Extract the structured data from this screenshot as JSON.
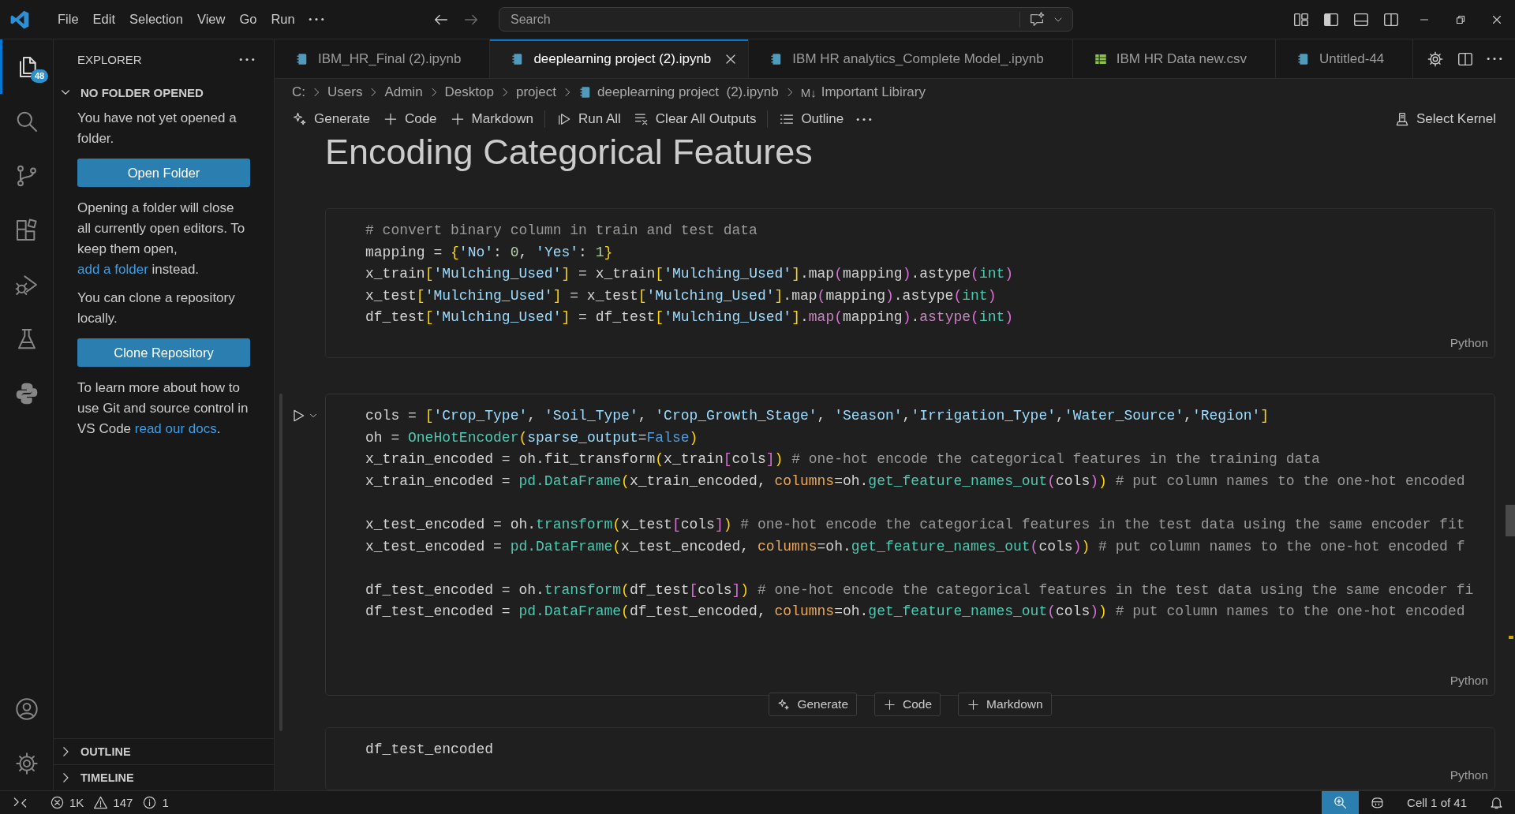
{
  "title_bar": {
    "menu": [
      "File",
      "Edit",
      "Selection",
      "View",
      "Go",
      "Run"
    ],
    "search": {
      "placeholder": "Search"
    }
  },
  "activity_bar": {
    "items": [
      {
        "kind": "files",
        "selected": true,
        "badge": "48"
      },
      {
        "kind": "search",
        "selected": false
      },
      {
        "kind": "source_control",
        "selected": false
      },
      {
        "kind": "extensions",
        "selected": false
      },
      {
        "kind": "run_debug",
        "selected": false
      },
      {
        "kind": "testing",
        "selected": false
      },
      {
        "kind": "python",
        "selected": false
      }
    ],
    "bottom": [
      {
        "kind": "accounts"
      },
      {
        "kind": "manage"
      }
    ]
  },
  "sidebar": {
    "title": "EXPLORER",
    "section": {
      "title": "NO FOLDER OPENED",
      "expanded": true
    },
    "content": [
      {
        "kind": "text",
        "text": "You have not yet opened a folder."
      },
      {
        "kind": "button",
        "label": "Open Folder"
      },
      {
        "kind": "text",
        "text": "Opening a folder will close all currently open editors. To keep them open, ",
        "link": "add a folder",
        "after": " instead."
      },
      {
        "kind": "text",
        "text": "You can clone a repository locally."
      },
      {
        "kind": "button",
        "label": "Clone Repository"
      },
      {
        "kind": "text",
        "text": "To learn more about how to use Git and source control in VS Code ",
        "link": "read our docs",
        "after": "."
      }
    ],
    "panels": [
      {
        "title": "OUTLINE",
        "expanded": false
      },
      {
        "title": "TIMELINE",
        "expanded": false
      }
    ]
  },
  "editor": {
    "tabs": [
      {
        "label": "IBM_HR_Final (2).ipynb",
        "kind": "notebook",
        "selected": false
      },
      {
        "label": "deeplearning project (2).ipynb",
        "kind": "notebook",
        "selected": true
      },
      {
        "label": "IBM HR analytics_Complete Model_.ipynb",
        "kind": "notebook",
        "selected": false
      },
      {
        "label": "IBM HR Data new.csv",
        "kind": "csv",
        "selected": false
      },
      {
        "label": "Untitled-44",
        "kind": "notebook",
        "selected": false
      }
    ],
    "breadcrumbs": [
      {
        "kind": "folder",
        "label": "C:"
      },
      {
        "kind": "folder",
        "label": "Users"
      },
      {
        "kind": "folder",
        "label": "Admin"
      },
      {
        "kind": "folder",
        "label": "Desktop"
      },
      {
        "kind": "folder",
        "label": "project"
      },
      {
        "kind": "notebook",
        "label": "deeplearning project  (2).ipynb"
      },
      {
        "kind": "markdown",
        "marker": "M↓",
        "label": "Important Libirary"
      }
    ],
    "toolbar": [
      {
        "kind": "generate",
        "label": "Generate"
      },
      {
        "kind": "add",
        "label": "Code"
      },
      {
        "kind": "add",
        "label": "Markdown"
      },
      {
        "kind": "separator"
      },
      {
        "kind": "run_all",
        "label": "Run All"
      },
      {
        "kind": "clear",
        "label": "Clear All Outputs"
      },
      {
        "kind": "separator"
      },
      {
        "kind": "outline",
        "label": "Outline"
      },
      {
        "kind": "more"
      }
    ],
    "kernel": "Select Kernel",
    "cells": [
      {
        "kind": "markdown",
        "heading": "Encoding Categorical Features"
      },
      {
        "kind": "code",
        "language": "Python",
        "focused": false,
        "lines": [
          {
            "tokens": [
              {
                "text": "# convert binary column in train and test data",
                "kind": "c"
              }
            ]
          },
          {
            "tokens": [
              {
                "text": "mapping = ",
                "kind": "p"
              },
              {
                "text": "{",
                "kind": "y"
              },
              {
                "text": "'No'",
                "kind": "s"
              },
              {
                "text": ": ",
                "kind": "p"
              },
              {
                "text": "0",
                "kind": "n"
              },
              {
                "text": ", ",
                "kind": "p"
              },
              {
                "text": "'Yes'",
                "kind": "s"
              },
              {
                "text": ": ",
                "kind": "p"
              },
              {
                "text": "1",
                "kind": "n"
              },
              {
                "text": "}",
                "kind": "y"
              }
            ]
          },
          {
            "tokens": [
              {
                "text": "x_train",
                "kind": "p"
              },
              {
                "text": "[",
                "kind": "y"
              },
              {
                "text": "'Mulching_Used'",
                "kind": "s"
              },
              {
                "text": "]",
                "kind": "y"
              },
              {
                "text": " = x_train",
                "kind": "p"
              },
              {
                "text": "[",
                "kind": "y"
              },
              {
                "text": "'Mulching_Used'",
                "kind": "s"
              },
              {
                "text": "]",
                "kind": "y"
              },
              {
                "text": ".map",
                "kind": "p"
              },
              {
                "text": "(",
                "kind": "m"
              },
              {
                "text": "mapping",
                "kind": "p"
              },
              {
                "text": ")",
                "kind": "m"
              },
              {
                "text": ".astype",
                "kind": "p"
              },
              {
                "text": "(",
                "kind": "m"
              },
              {
                "text": "int",
                "kind": "t"
              },
              {
                "text": ")",
                "kind": "m"
              }
            ]
          },
          {
            "tokens": [
              {
                "text": "x_test",
                "kind": "p"
              },
              {
                "text": "[",
                "kind": "y"
              },
              {
                "text": "'Mulching_Used'",
                "kind": "s"
              },
              {
                "text": "]",
                "kind": "y"
              },
              {
                "text": " = x_test",
                "kind": "p"
              },
              {
                "text": "[",
                "kind": "y"
              },
              {
                "text": "'Mulching_Used'",
                "kind": "s"
              },
              {
                "text": "]",
                "kind": "y"
              },
              {
                "text": ".map",
                "kind": "p"
              },
              {
                "text": "(",
                "kind": "m"
              },
              {
                "text": "mapping",
                "kind": "p"
              },
              {
                "text": ")",
                "kind": "m"
              },
              {
                "text": ".astype",
                "kind": "p"
              },
              {
                "text": "(",
                "kind": "m"
              },
              {
                "text": "int",
                "kind": "t"
              },
              {
                "text": ")",
                "kind": "m"
              }
            ]
          },
          {
            "tokens": [
              {
                "text": "df_test",
                "kind": "p"
              },
              {
                "text": "[",
                "kind": "y"
              },
              {
                "text": "'Mulching_Used'",
                "kind": "s"
              },
              {
                "text": "]",
                "kind": "y"
              },
              {
                "text": " = df_test",
                "kind": "p"
              },
              {
                "text": "[",
                "kind": "y"
              },
              {
                "text": "'Mulching_Used'",
                "kind": "s"
              },
              {
                "text": "]",
                "kind": "y"
              },
              {
                "text": ".",
                "kind": "p"
              },
              {
                "text": "map",
                "kind": "u"
              },
              {
                "text": "(",
                "kind": "m"
              },
              {
                "text": "mapping",
                "kind": "p"
              },
              {
                "text": ")",
                "kind": "m"
              },
              {
                "text": ".",
                "kind": "p"
              },
              {
                "text": "astype",
                "kind": "u"
              },
              {
                "text": "(",
                "kind": "m"
              },
              {
                "text": "int",
                "kind": "t"
              },
              {
                "text": ")",
                "kind": "m"
              }
            ]
          }
        ]
      },
      {
        "kind": "code",
        "language": "Python",
        "focused": true,
        "lines": [
          {
            "tokens": [
              {
                "text": "cols = ",
                "kind": "p"
              },
              {
                "text": "[",
                "kind": "y"
              },
              {
                "text": "'Crop_Type'",
                "kind": "s"
              },
              {
                "text": ", ",
                "kind": "p"
              },
              {
                "text": "'Soil_Type'",
                "kind": "s"
              },
              {
                "text": ", ",
                "kind": "p"
              },
              {
                "text": "'Crop_Growth_Stage'",
                "kind": "s"
              },
              {
                "text": ", ",
                "kind": "p"
              },
              {
                "text": "'Season'",
                "kind": "s"
              },
              {
                "text": ",",
                "kind": "p"
              },
              {
                "text": "'Irrigation_Type'",
                "kind": "s"
              },
              {
                "text": ",",
                "kind": "p"
              },
              {
                "text": "'Water_Source'",
                "kind": "s"
              },
              {
                "text": ",",
                "kind": "p"
              },
              {
                "text": "'Region'",
                "kind": "s"
              },
              {
                "text": "]",
                "kind": "y"
              }
            ]
          },
          {
            "tokens": [
              {
                "text": "oh = ",
                "kind": "p"
              },
              {
                "text": "OneHotEncoder",
                "kind": "t"
              },
              {
                "text": "(",
                "kind": "y"
              },
              {
                "text": "sparse_output",
                "kind": "s"
              },
              {
                "text": "=",
                "kind": "p"
              },
              {
                "text": "False",
                "kind": "k"
              },
              {
                "text": ")",
                "kind": "y"
              }
            ]
          },
          {
            "tokens": [
              {
                "text": "x_train_encoded = oh.fit_transform",
                "kind": "p"
              },
              {
                "text": "(",
                "kind": "y"
              },
              {
                "text": "x_train",
                "kind": "p"
              },
              {
                "text": "[",
                "kind": "m"
              },
              {
                "text": "cols",
                "kind": "p"
              },
              {
                "text": "]",
                "kind": "m"
              },
              {
                "text": ")",
                "kind": "y"
              },
              {
                "text": " # one-hot encode the categorical features in the training data",
                "kind": "c"
              }
            ]
          },
          {
            "tokens": [
              {
                "text": "x_train_encoded = ",
                "kind": "p"
              },
              {
                "text": "pd.DataFrame",
                "kind": "t"
              },
              {
                "text": "(",
                "kind": "y"
              },
              {
                "text": "x_train_encoded, ",
                "kind": "p"
              },
              {
                "text": "columns",
                "kind": "o"
              },
              {
                "text": "=oh.",
                "kind": "p"
              },
              {
                "text": "get_feature_names_out",
                "kind": "t"
              },
              {
                "text": "(",
                "kind": "m"
              },
              {
                "text": "cols",
                "kind": "p"
              },
              {
                "text": ")",
                "kind": "m"
              },
              {
                "text": ")",
                "kind": "y"
              },
              {
                "text": " # put column names to the one-hot encoded",
                "kind": "c"
              }
            ]
          },
          {
            "kind": "blank"
          },
          {
            "tokens": [
              {
                "text": "x_test_encoded = oh.",
                "kind": "p"
              },
              {
                "text": "transform",
                "kind": "t"
              },
              {
                "text": "(",
                "kind": "y"
              },
              {
                "text": "x_test",
                "kind": "p"
              },
              {
                "text": "[",
                "kind": "m"
              },
              {
                "text": "cols",
                "kind": "p"
              },
              {
                "text": "]",
                "kind": "m"
              },
              {
                "text": ")",
                "kind": "y"
              },
              {
                "text": " # one-hot encode the categorical features in the test data using the same encoder fit",
                "kind": "c"
              }
            ]
          },
          {
            "tokens": [
              {
                "text": "x_test_encoded = ",
                "kind": "p"
              },
              {
                "text": "pd.DataFrame",
                "kind": "t"
              },
              {
                "text": "(",
                "kind": "y"
              },
              {
                "text": "x_test_encoded, ",
                "kind": "p"
              },
              {
                "text": "columns",
                "kind": "o"
              },
              {
                "text": "=oh.",
                "kind": "p"
              },
              {
                "text": "get_feature_names_out",
                "kind": "t"
              },
              {
                "text": "(",
                "kind": "m"
              },
              {
                "text": "cols",
                "kind": "p"
              },
              {
                "text": ")",
                "kind": "m"
              },
              {
                "text": ")",
                "kind": "y"
              },
              {
                "text": " # put column names to the one-hot encoded f",
                "kind": "c"
              }
            ]
          },
          {
            "kind": "blank"
          },
          {
            "tokens": [
              {
                "text": "df_test_encoded = oh.",
                "kind": "p"
              },
              {
                "text": "transform",
                "kind": "t"
              },
              {
                "text": "(",
                "kind": "y"
              },
              {
                "text": "df_test",
                "kind": "p"
              },
              {
                "text": "[",
                "kind": "m"
              },
              {
                "text": "cols",
                "kind": "p"
              },
              {
                "text": "]",
                "kind": "m"
              },
              {
                "text": ")",
                "kind": "y"
              },
              {
                "text": " # one-hot encode the categorical features in the test data using the same encoder fi",
                "kind": "c"
              }
            ]
          },
          {
            "tokens": [
              {
                "text": "df_test_encoded = ",
                "kind": "p"
              },
              {
                "text": "pd.DataFrame",
                "kind": "t"
              },
              {
                "text": "(",
                "kind": "y"
              },
              {
                "text": "df_test_encoded, ",
                "kind": "p"
              },
              {
                "text": "columns",
                "kind": "o"
              },
              {
                "text": "=oh.",
                "kind": "p"
              },
              {
                "text": "get_feature_names_out",
                "kind": "t"
              },
              {
                "text": "(",
                "kind": "m"
              },
              {
                "text": "cols",
                "kind": "p"
              },
              {
                "text": ")",
                "kind": "m"
              },
              {
                "text": ")",
                "kind": "y"
              },
              {
                "text": " # put column names to the one-hot encoded",
                "kind": "c"
              }
            ]
          },
          {
            "kind": "blank"
          },
          {
            "kind": "blank"
          }
        ]
      },
      {
        "kind": "insert_toolbar",
        "actions": [
          {
            "kind": "generate",
            "label": "Generate"
          },
          {
            "kind": "add",
            "label": "Code"
          },
          {
            "kind": "add",
            "label": "Markdown"
          }
        ]
      },
      {
        "kind": "code",
        "language": "Python",
        "focused": false,
        "lines": [
          {
            "tokens": [
              {
                "text": "df_test_encoded",
                "kind": "p"
              }
            ]
          }
        ]
      }
    ]
  },
  "status_bar": {
    "left": [
      {
        "kind": "remote"
      },
      {
        "kind": "errors",
        "text": "1K"
      },
      {
        "kind": "warnings",
        "text": "147"
      },
      {
        "kind": "info",
        "text": "1"
      }
    ],
    "right": [
      {
        "kind": "zoom",
        "active": true
      },
      {
        "kind": "copilot"
      },
      {
        "kind": "text",
        "text": "Cell 1 of 41"
      },
      {
        "kind": "notifications"
      }
    ]
  }
}
